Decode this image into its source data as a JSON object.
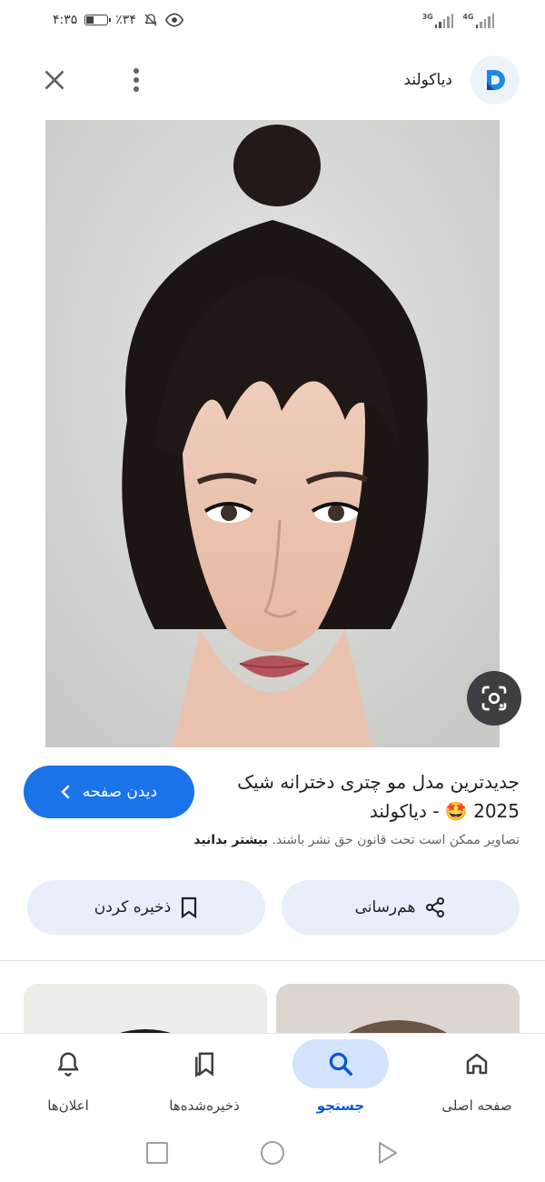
{
  "status_bar": {
    "time": "۴:۳۵",
    "battery": "٪۳۴",
    "battery_level": 0.34,
    "network_1": "4G",
    "network_2": "3G"
  },
  "header": {
    "site_name": "دیاکولند",
    "logo_icon": "diakoland-logo-icon",
    "menu_icon": "more-vert-icon",
    "close_icon": "close-icon"
  },
  "image": {
    "lens_icon": "google-lens-icon"
  },
  "info": {
    "title": "جدیدترین مدل مو چتری دخترانه شیک 2025 🤩 - دیاکولند",
    "visit_label": "دیدن صفحه",
    "copyright_text": "تصاویر ممکن است تحت قانون حق نشر باشند.",
    "learn_more": "بیشتر بدانید",
    "share_label": "هم‌رسانی",
    "save_label": "ذخیره کردن"
  },
  "bottom_nav": {
    "items": [
      {
        "label": "صفحه اصلی",
        "icon": "home-icon",
        "active": false
      },
      {
        "label": "جستجو",
        "icon": "search-icon",
        "active": true
      },
      {
        "label": "ذخیره‌شده‌ها",
        "icon": "bookmarks-icon",
        "active": false
      },
      {
        "label": "اعلان‌ها",
        "icon": "bell-icon",
        "active": false
      }
    ]
  },
  "colors": {
    "accent": "#1a73e8",
    "chip_bg": "#e8eefa",
    "active_nav_bg": "#d3e3fd"
  }
}
